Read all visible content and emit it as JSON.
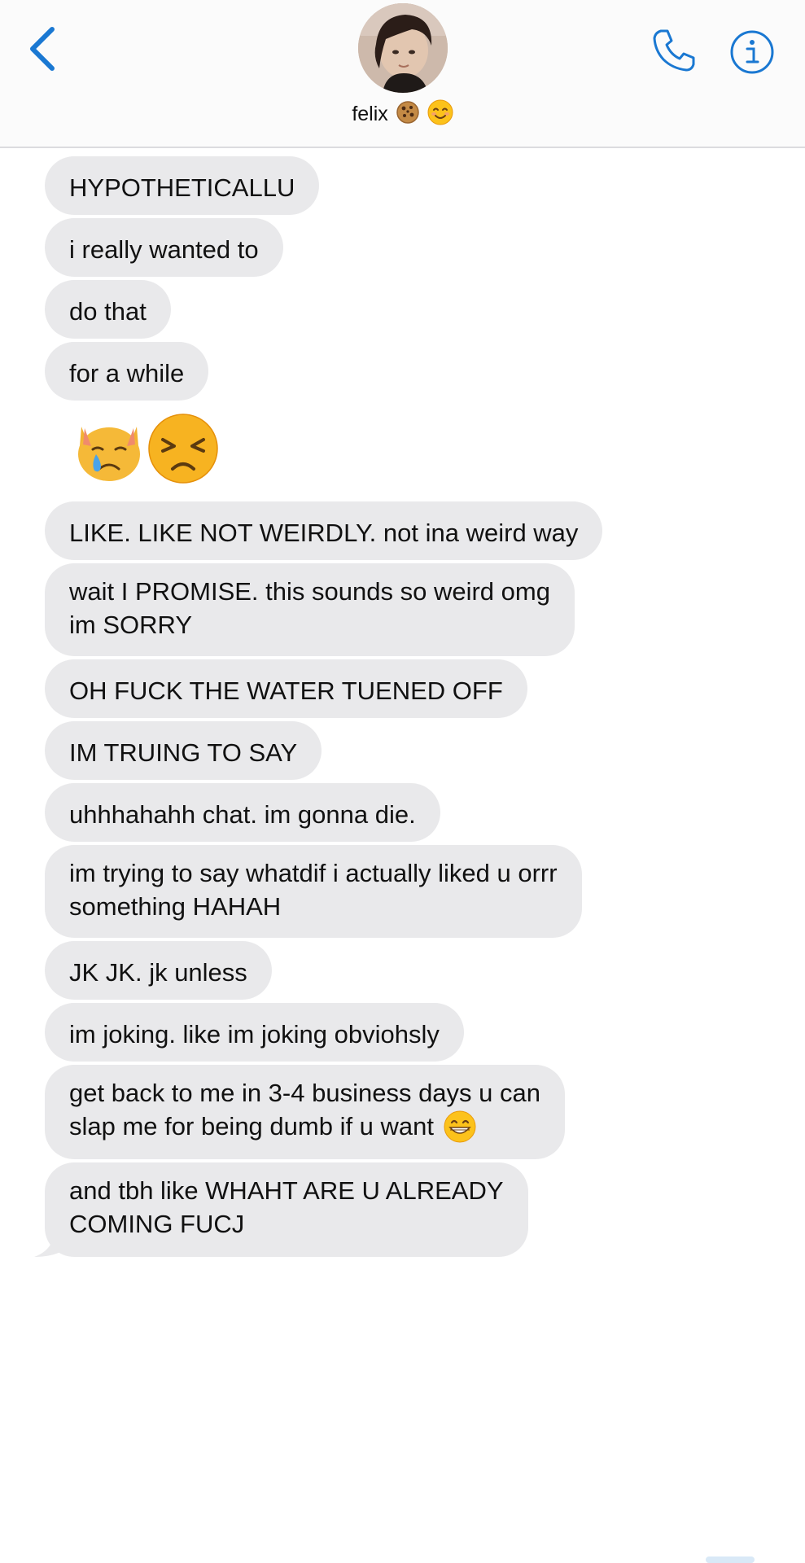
{
  "header": {
    "contact_name": "felix",
    "contact_emojis": [
      "cookie",
      "smiling-face"
    ],
    "back_icon": "chevron-left-icon",
    "call_icon": "phone-icon",
    "info_icon": "info-icon",
    "accent_color": "#1a78d2"
  },
  "messages": [
    {
      "text": "HYPOTHETICALLU"
    },
    {
      "text": "i really wanted to"
    },
    {
      "text": "do that"
    },
    {
      "text": "for a while"
    },
    {
      "emojis": [
        "crying-cat-face",
        "persevering-face"
      ]
    },
    {
      "text": "LIKE. LIKE NOT WEIRDLY. not ina weird way"
    },
    {
      "lines": [
        "wait I PROMISE. this sounds so weird omg",
        "im SORRY"
      ]
    },
    {
      "text": "OH FUCK THE WATER TUENED OFF"
    },
    {
      "text": "IM TRUING TO SAY"
    },
    {
      "text": "uhhhahahh chat. im gonna die."
    },
    {
      "lines": [
        "im trying to say whatdif i actually liked u orrr",
        "something HAHAH"
      ]
    },
    {
      "text": "JK JK. jk unless"
    },
    {
      "text": "im joking. like im joking obviohsly"
    },
    {
      "lines": [
        "get back to me in 3-4 business days u can",
        "slap me for being dumb if u want"
      ],
      "trailing_emoji": "grinning-face"
    },
    {
      "lines": [
        "and tbh like WHAHT ARE U ALREADY",
        "COMING FUCJ"
      ]
    }
  ],
  "colors": {
    "bubble_background": "#e9e9eb",
    "text": "#111111",
    "header_background": "#fbfbfb"
  }
}
